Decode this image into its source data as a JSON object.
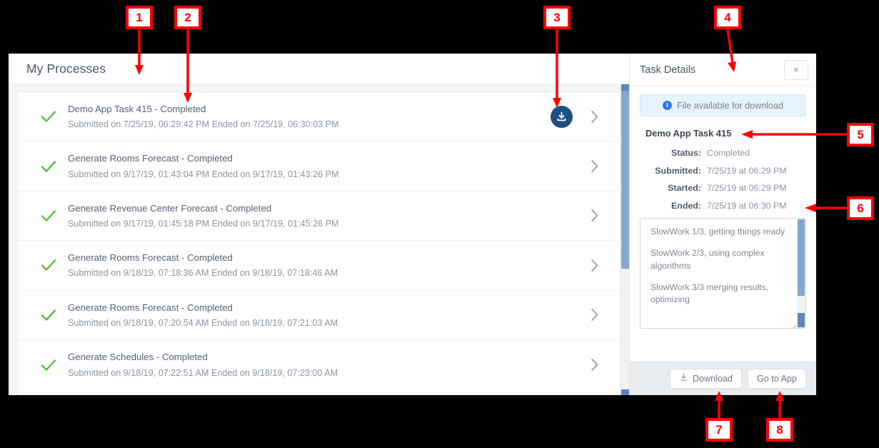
{
  "window": {
    "processes": {
      "title": "My Processes",
      "rows": [
        {
          "status_icon": "check-icon",
          "title": "Demo App Task 415 - Completed",
          "subtitle": "Submitted on 7/25/19, 06:29:42 PM Ended on 7/25/19, 06:30:03 PM",
          "has_download": true
        },
        {
          "status_icon": "check-icon",
          "title": "Generate Rooms Forecast - Completed",
          "subtitle": "Submitted on 9/17/19, 01:43:04 PM Ended on 9/17/19, 01:43:26 PM",
          "has_download": false
        },
        {
          "status_icon": "check-icon",
          "title": "Generate Revenue Center Forecast - Completed",
          "subtitle": "Submitted on 9/17/19, 01:45:18 PM Ended on 9/17/19, 01:45:26 PM",
          "has_download": false
        },
        {
          "status_icon": "check-icon",
          "title": "Generate Rooms Forecast - Completed",
          "subtitle": "Submitted on 9/18/19, 07:18:36 AM Ended on 9/18/19, 07:18:46 AM",
          "has_download": false
        },
        {
          "status_icon": "check-icon",
          "title": "Generate Rooms Forecast - Completed",
          "subtitle": "Submitted on 9/18/19, 07:20:54 AM Ended on 9/18/19, 07:21:03 AM",
          "has_download": false
        },
        {
          "status_icon": "check-icon",
          "title": "Generate Schedules - Completed",
          "subtitle": "Submitted on 9/18/19, 07:22:51 AM Ended on 9/18/19, 07:23:00 AM",
          "has_download": false
        }
      ]
    },
    "details": {
      "title": "Task Details",
      "close_label": "×",
      "alert": {
        "icon": "info-icon",
        "text": "File available for download"
      },
      "task_name": "Demo App Task 415",
      "fields": [
        {
          "label": "Status:",
          "value": "Completed"
        },
        {
          "label": "Submitted:",
          "value": "7/25/19 at 06:29 PM"
        },
        {
          "label": "Started:",
          "value": "7/25/19 at 06:29 PM"
        },
        {
          "label": "Ended:",
          "value": "7/25/19 at 06:30 PM"
        }
      ],
      "log_lines": [
        "SlowWork 1/3, getting things ready",
        "SlowWork 2/3, using complex algorithms",
        "SlowWork 3/3 merging results, optimizing"
      ],
      "footer": {
        "download_label": "Download",
        "goto_label": "Go to App"
      }
    }
  },
  "annotations": {
    "badges": [
      {
        "number": "1"
      },
      {
        "number": "2"
      },
      {
        "number": "3"
      },
      {
        "number": "4"
      },
      {
        "number": "5"
      },
      {
        "number": "6"
      },
      {
        "number": "7"
      },
      {
        "number": "8"
      }
    ],
    "color": "#ff0000"
  },
  "colors": {
    "accent_download_circle": "#1d4f82",
    "check_green": "#5fba46",
    "info_blue": "#2c7be5",
    "alert_bg": "#e7f3fc",
    "panel_bg": "#f4f5f7",
    "footer_bg": "#e9ecef",
    "scrollbar_thumb": "#84a6d0"
  }
}
